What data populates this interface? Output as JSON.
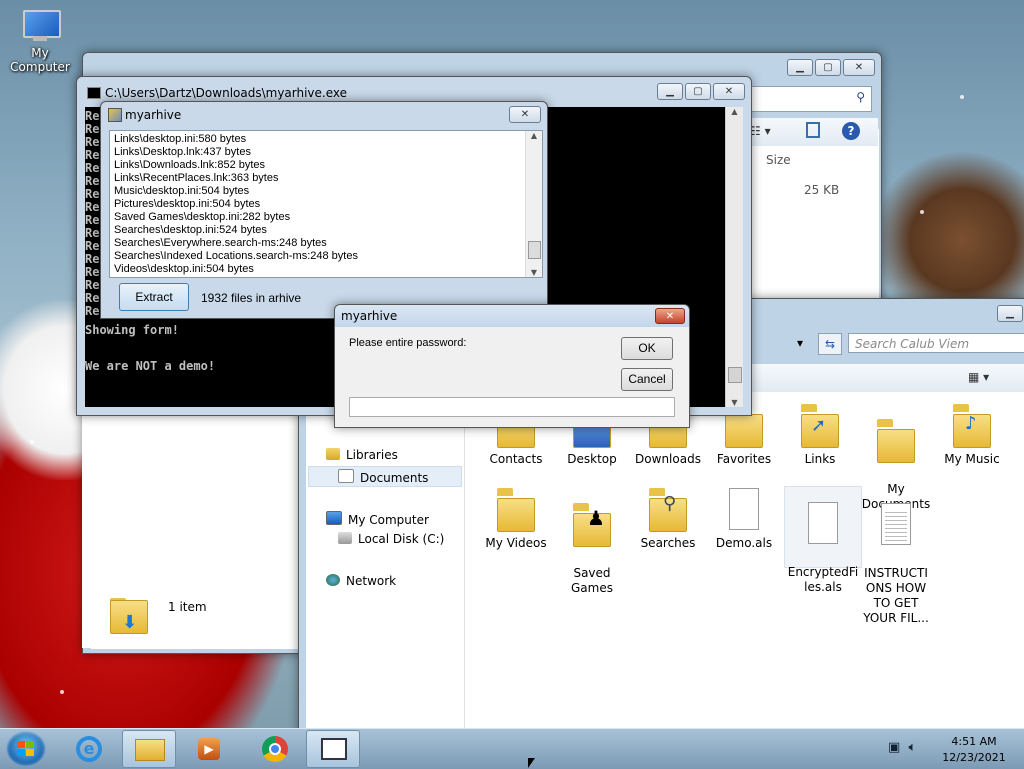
{
  "desktop": {
    "icon_label": "My Computer"
  },
  "back_explorer": {
    "column_size": "Size",
    "size_value": "25 KB",
    "item_count": "1 item"
  },
  "front_explorer": {
    "search_placeholder": "Search Calub Viem",
    "nav": {
      "libraries": "Libraries",
      "documents": "Documents",
      "my_computer": "My Computer",
      "local_disk": "Local Disk (C:)",
      "network": "Network"
    },
    "files_row1": [
      "Contacts",
      "Desktop",
      "Downloads",
      "Favorites",
      "Links",
      "My\nDocuments",
      "My Music"
    ],
    "files_row2": [
      "My Videos",
      "Saved\nGames",
      "Searches",
      "Demo.als",
      "EncryptedFi\nles.als",
      "INSTRUCTI\nONS HOW\nTO GET\nYOUR FIL..."
    ]
  },
  "console": {
    "title": "C:\\Users\\Dartz\\Downloads\\myarhive.exe",
    "re_prefix": "Re",
    "line_showing": "Showing form!",
    "line_demo": "We are NOT a demo!"
  },
  "archive": {
    "title": "myarhive",
    "rows": [
      "Links\\desktop.ini:580 bytes",
      "Links\\Desktop.lnk:437 bytes",
      "Links\\Downloads.lnk:852 bytes",
      "Links\\RecentPlaces.lnk:363 bytes",
      "Music\\desktop.ini:504 bytes",
      "Pictures\\desktop.ini:504 bytes",
      "Saved Games\\desktop.ini:282 bytes",
      "Searches\\desktop.ini:524 bytes",
      "Searches\\Everywhere.search-ms:248 bytes",
      "Searches\\Indexed Locations.search-ms:248 bytes",
      "Videos\\desktop.ini:504 bytes"
    ],
    "extract_label": "Extract",
    "count_text": "1932 files in arhive"
  },
  "password_dialog": {
    "title": "myarhive",
    "prompt": "Please entire password:",
    "ok_label": "OK",
    "cancel_label": "Cancel",
    "input_value": ""
  },
  "taskbar": {
    "time": "4:51 AM",
    "date": "12/23/2021"
  }
}
